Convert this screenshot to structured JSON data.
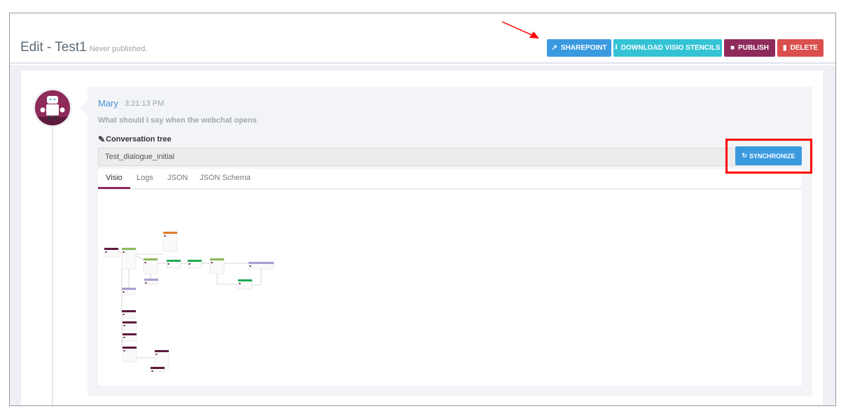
{
  "header": {
    "title": "Edit - Test1",
    "status": "Never published."
  },
  "buttons": {
    "sharepoint": "SHAREPOINT",
    "download": "DOWNLOAD VISIO STENCILS",
    "publish": "PUBLISH",
    "delete": "DELETE"
  },
  "colors": {
    "sharepoint": "#3a9ae0",
    "download": "#33c3d4",
    "publish": "#8e2b5b",
    "delete": "#db4f4f",
    "annotation": "#ff0000"
  },
  "message": {
    "author": "Mary",
    "time": "3:21:13 PM",
    "question": "What should I say when the webchat opens"
  },
  "tree": {
    "label": "Conversation tree",
    "value": "Test_dialogue_initial",
    "sync_label": "SYNCHRONIZE"
  },
  "tabs": [
    {
      "label": "Visio",
      "active": true
    },
    {
      "label": "Logs"
    },
    {
      "label": "JSON"
    },
    {
      "label": "JSON Schema"
    }
  ]
}
